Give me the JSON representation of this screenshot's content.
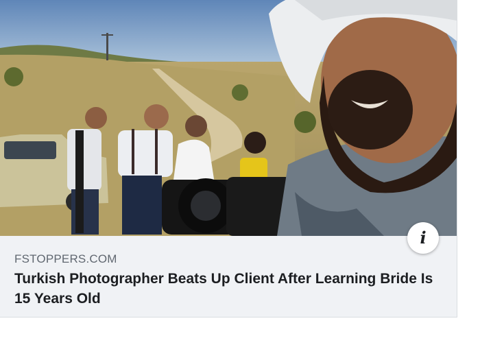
{
  "link_preview": {
    "source": "FSTOPPERS.COM",
    "headline": "Turkish Photographer Beats Up Client After Learning Bride Is 15 Years Old",
    "info_icon": "i"
  },
  "colors": {
    "card_background": "#f0f2f5",
    "source_text": "#606770",
    "headline_text": "#1c1e21"
  }
}
